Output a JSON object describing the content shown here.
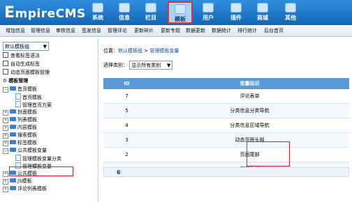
{
  "brand": {
    "logo_first": "E",
    "logo_rest": "mpireCMS"
  },
  "nav": [
    {
      "label": "系统",
      "icon": "system-icon"
    },
    {
      "label": "信息",
      "icon": "info-icon"
    },
    {
      "label": "栏目",
      "icon": "column-icon"
    },
    {
      "label": "模板",
      "icon": "template-icon",
      "active": true
    },
    {
      "label": "用户",
      "icon": "user-icon"
    },
    {
      "label": "插件",
      "icon": "plugin-icon"
    },
    {
      "label": "商城",
      "icon": "shop-icon"
    },
    {
      "label": "其他",
      "icon": "other-icon"
    }
  ],
  "subnav": [
    "增加信息",
    "管理信息",
    "审核信息",
    "签发信息",
    "管理评论",
    "更新碎片",
    "更新专题",
    "数据更新",
    "数据统计",
    "排行统计",
    "后台首页"
  ],
  "sidebar": {
    "group_select": "默认模板组",
    "links": [
      "查看标签语法",
      "自动生成标签",
      "动态页面模板管理"
    ],
    "tree_title": "模板管理",
    "tree": [
      {
        "label": "首页模板",
        "kind": "folder",
        "sign": "−"
      },
      {
        "label": "首页模板",
        "kind": "doc"
      },
      {
        "label": "管理首页方案",
        "kind": "doc"
      },
      {
        "label": "封面模板",
        "kind": "folder",
        "sign": "+"
      },
      {
        "label": "列表模板",
        "kind": "folder",
        "sign": "+"
      },
      {
        "label": "内容模板",
        "kind": "folder",
        "sign": "+"
      },
      {
        "label": "搜索模板",
        "kind": "folder",
        "sign": "+"
      },
      {
        "label": "标签模板",
        "kind": "folder",
        "sign": "+"
      },
      {
        "label": "公共模板变量",
        "kind": "folder",
        "sign": "−"
      },
      {
        "label": "管理模板变量分类",
        "kind": "doc"
      },
      {
        "label": "管理模板变量",
        "kind": "doc"
      },
      {
        "label": "公共模板",
        "kind": "folder",
        "sign": "+"
      },
      {
        "label": "JS模板",
        "kind": "folder",
        "sign": "+"
      },
      {
        "label": "评论列表模板",
        "kind": "folder",
        "sign": "+"
      }
    ]
  },
  "main": {
    "breadcrumb": {
      "prefix": "位置：",
      "group": "默认模板组",
      "sep": " > ",
      "page": "管理模板变量"
    },
    "filter": {
      "label": "选择类别：",
      "value": "显示所有类别"
    },
    "table": {
      "headers": [
        "ID",
        "变量标识"
      ],
      "rows": [
        {
          "id": "7",
          "name": "评论表单"
        },
        {
          "id": "5",
          "name": "分类信息分类导航"
        },
        {
          "id": "4",
          "name": "分类信息区域导航"
        },
        {
          "id": "3",
          "name": "动态页面头部"
        },
        {
          "id": "2",
          "name": "页面尾部"
        },
        {
          "id": "1",
          "name": "页面头部"
        }
      ]
    },
    "pager": "6"
  }
}
